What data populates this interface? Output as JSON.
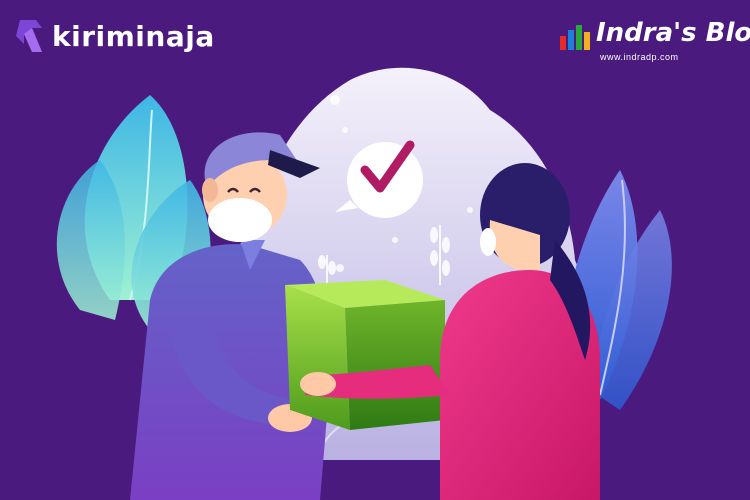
{
  "brand": {
    "name": "kiriminaja"
  },
  "watermark": {
    "title": "Indra's Blog",
    "url": "www.indradp.com"
  },
  "illustration": {
    "subject": "courier handing a package to a customer",
    "icons": [
      "check-mark-speech-bubble-icon"
    ]
  },
  "colors": {
    "background": "#4a1a7e",
    "cloud": "#e9e6f5",
    "box": "#7bbf2a",
    "courier_shirt": "#5a57b8",
    "customer_shirt": "#e0227a",
    "check": "#b01c63"
  }
}
